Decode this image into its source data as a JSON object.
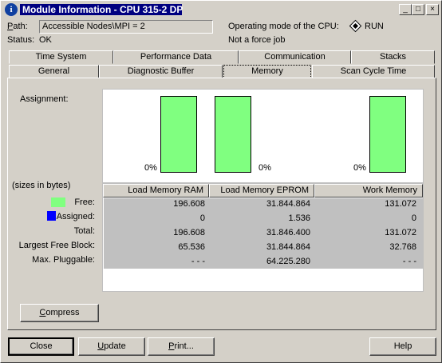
{
  "window": {
    "title": "Module Information - CPU 315-2 DP"
  },
  "header": {
    "path_label": "Path:",
    "path_value": "Accessible Nodes\\MPI =  2",
    "status_label": "Status:",
    "status_value": "OK",
    "opmode_label": "Operating mode of the  CPU:",
    "opmode_value": "RUN",
    "force_text": "Not a force job"
  },
  "tabs_row1": [
    "Time System",
    "Performance Data",
    "Communication",
    "Stacks"
  ],
  "tabs_row2": [
    "General",
    "Diagnostic Buffer",
    "Memory",
    "Scan Cycle Time"
  ],
  "memory": {
    "assignment_label": "Assignment:",
    "sizes_label": "(sizes in bytes)",
    "bars": [
      {
        "name": "Load Memory RAM",
        "assigned_pct_label": "0%",
        "assigned_fraction": 0.0
      },
      {
        "name": "Load Memory EPROM",
        "assigned_pct_label": "0%",
        "assigned_fraction": 0.0
      },
      {
        "name": "Work Memory",
        "assigned_pct_label": "0%",
        "assigned_fraction": 0.0
      }
    ],
    "columns": [
      "Load Memory RAM",
      "Load Memory EPROM",
      "Work Memory"
    ],
    "rows": [
      {
        "label": "Free:",
        "values": [
          "196.608",
          "31.844.864",
          "131.072"
        ]
      },
      {
        "label": "Assigned:",
        "values": [
          "0",
          "1.536",
          "0"
        ]
      },
      {
        "label": "Total:",
        "values": [
          "196.608",
          "31.846.400",
          "131.072"
        ]
      },
      {
        "label": "Largest Free Block:",
        "values": [
          "65.536",
          "31.844.864",
          "32.768"
        ]
      },
      {
        "label": "Max. Pluggable:",
        "values": [
          "- - -",
          "64.225.280",
          "- - -"
        ]
      }
    ],
    "compress_label": "Compress"
  },
  "colors": {
    "free": "#80ff80",
    "assigned": "#0000ff",
    "title_bar": "#000080"
  },
  "buttons": {
    "close": "Close",
    "update": "Update",
    "print": "Print...",
    "help": "Help"
  }
}
